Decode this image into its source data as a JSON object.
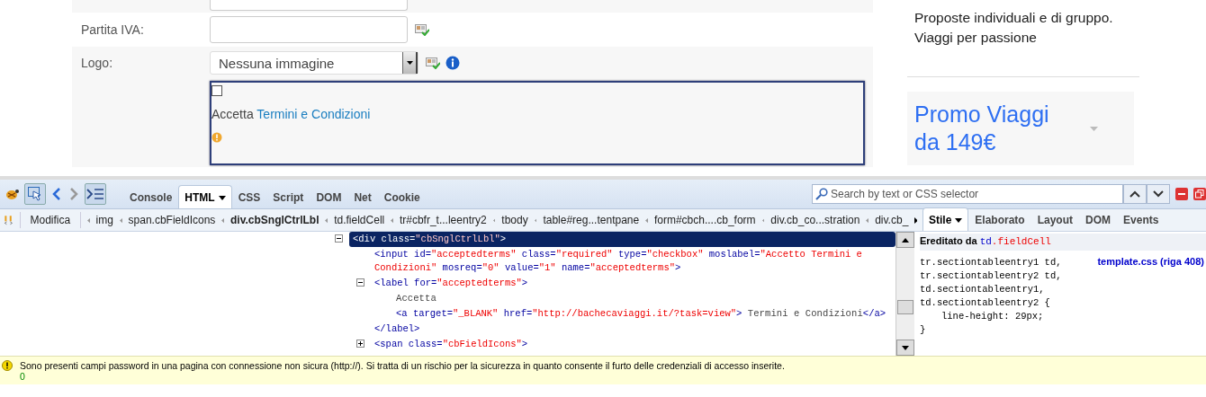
{
  "form": {
    "rows": [
      {
        "kind": "partial_text"
      },
      {
        "kind": "text",
        "label": "Partita IVA:",
        "info_icon": false
      },
      {
        "kind": "select",
        "label": "Logo:",
        "value": "Nessuna immagine",
        "info_icon": true
      },
      {
        "kind": "terms",
        "checked": false,
        "focused": true,
        "label_prefix": "Accetta",
        "link": "Termini e Condizioni"
      }
    ]
  },
  "sidebar": {
    "tagline": "Proposte individuali e di gruppo. Viaggi per passione",
    "promo": "Promo Viaggi da 149€"
  },
  "devtools": {
    "inspect_active": true,
    "tabs": [
      {
        "label": "Console",
        "selected": false,
        "menu": false
      },
      {
        "label": "HTML",
        "selected": true,
        "menu": true
      },
      {
        "label": "CSS",
        "selected": false,
        "menu": false
      },
      {
        "label": "Script",
        "selected": false,
        "menu": false
      },
      {
        "label": "DOM",
        "selected": false,
        "menu": false
      },
      {
        "label": "Net",
        "selected": false,
        "menu": false
      },
      {
        "label": "Cookie",
        "selected": false,
        "menu": false
      }
    ],
    "search": {
      "placeholder": "Search by text or CSS selector"
    },
    "breadcrumb": {
      "edit_button": "Modifica",
      "items": [
        {
          "label": "img",
          "selected": false
        },
        {
          "label": "span.cbFieldIcons",
          "selected": false
        },
        {
          "label": "div.cbSnglCtrlLbl",
          "selected": true
        },
        {
          "label": "td.fieldCell",
          "selected": false
        },
        {
          "label": "tr#cbfr_t...leentry2",
          "selected": false
        },
        {
          "label": "tbody",
          "selected": false
        },
        {
          "label": "table#reg...tentpane",
          "selected": false
        },
        {
          "label": "form#cbch....cb_form",
          "selected": false
        },
        {
          "label": "div.cb_co...stration",
          "selected": false
        },
        {
          "label": "div.cb_",
          "selected": false
        }
      ]
    },
    "html_tree": [
      {
        "kind": "element",
        "expanded": true,
        "selected": true,
        "segments": [
          {
            "kind": "tag",
            "text": "<div class="
          },
          {
            "kind": "val",
            "text": "\"cbSnglCtrlLbl\""
          },
          {
            "kind": "tag",
            "text": ">"
          }
        ],
        "children": [
          {
            "kind": "leaf",
            "selected": false,
            "segments": [
              {
                "kind": "tag",
                "text": "<input id="
              },
              {
                "kind": "val",
                "text": "\"acceptedterms\""
              },
              {
                "kind": "tag",
                "text": " class="
              },
              {
                "kind": "val",
                "text": "\"required\""
              },
              {
                "kind": "tag",
                "text": " type="
              },
              {
                "kind": "val",
                "text": "\"checkbox\""
              },
              {
                "kind": "tag",
                "text": " moslabel="
              },
              {
                "kind": "val",
                "text": "\"Accetto Termini e Condizioni\""
              },
              {
                "kind": "tag",
                "text": " mosreq="
              },
              {
                "kind": "val",
                "text": "\"0\""
              },
              {
                "kind": "tag",
                "text": " value="
              },
              {
                "kind": "val",
                "text": "\"1\""
              },
              {
                "kind": "tag",
                "text": " name="
              },
              {
                "kind": "val",
                "text": "\"acceptedterms\""
              },
              {
                "kind": "tag",
                "text": ">"
              }
            ]
          },
          {
            "kind": "element",
            "expanded": true,
            "selected": false,
            "segments": [
              {
                "kind": "tag",
                "text": "<label for="
              },
              {
                "kind": "val",
                "text": "\"acceptedterms\""
              },
              {
                "kind": "tag",
                "text": ">"
              }
            ],
            "children": [
              {
                "kind": "leaf",
                "selected": false,
                "segments": [
                  {
                    "kind": "text",
                    "text": "Accetta"
                  }
                ]
              },
              {
                "kind": "leaf",
                "selected": false,
                "segments": [
                  {
                    "kind": "tag",
                    "text": "<a target="
                  },
                  {
                    "kind": "val",
                    "text": "\"_BLANK\""
                  },
                  {
                    "kind": "tag",
                    "text": " href="
                  },
                  {
                    "kind": "val",
                    "text": "\"http://bachecaviaggi.it/?task=view\""
                  },
                  {
                    "kind": "tag",
                    "text": ">"
                  },
                  {
                    "kind": "text",
                    "text": " Termini e Condizioni"
                  },
                  {
                    "kind": "tag",
                    "text": "</a>"
                  }
                ]
              }
            ],
            "close": [
              {
                "kind": "tag",
                "text": "</label>"
              }
            ]
          },
          {
            "kind": "element",
            "expanded": false,
            "selected": false,
            "segments": [
              {
                "kind": "tag",
                "text": "<span class="
              },
              {
                "kind": "val",
                "text": "\"cbFieldIcons\""
              },
              {
                "kind": "tag",
                "text": ">"
              }
            ]
          }
        ]
      }
    ],
    "side_panel": {
      "tabs": [
        {
          "label": "Stile",
          "selected": true,
          "menu": true
        },
        {
          "label": "Elaborato",
          "selected": false,
          "menu": false
        },
        {
          "label": "Layout",
          "selected": false,
          "menu": false
        },
        {
          "label": "DOM",
          "selected": false,
          "menu": false
        },
        {
          "label": "Events",
          "selected": false,
          "menu": false
        }
      ],
      "inherited_prefix": "Ereditato da",
      "inherited_tag": "td",
      "inherited_class": ".fieldCell",
      "selectors": [
        "tr.sectiontableentry1 td,",
        "tr.sectiontableentry2 td,",
        "td.sectiontableentry1,",
        "td.sectiontableentry2 {"
      ],
      "source": "template.css (riga 408)",
      "declarations": [
        "line-height: 29px;"
      ],
      "close": "}"
    },
    "notice": {
      "message": "Sono presenti campi password in una pagina con connessione non sicura (http://). Si tratta di un rischio per la sicurezza in quanto consente il furto delle credenziali di accesso inserite.",
      "count": "0"
    }
  }
}
